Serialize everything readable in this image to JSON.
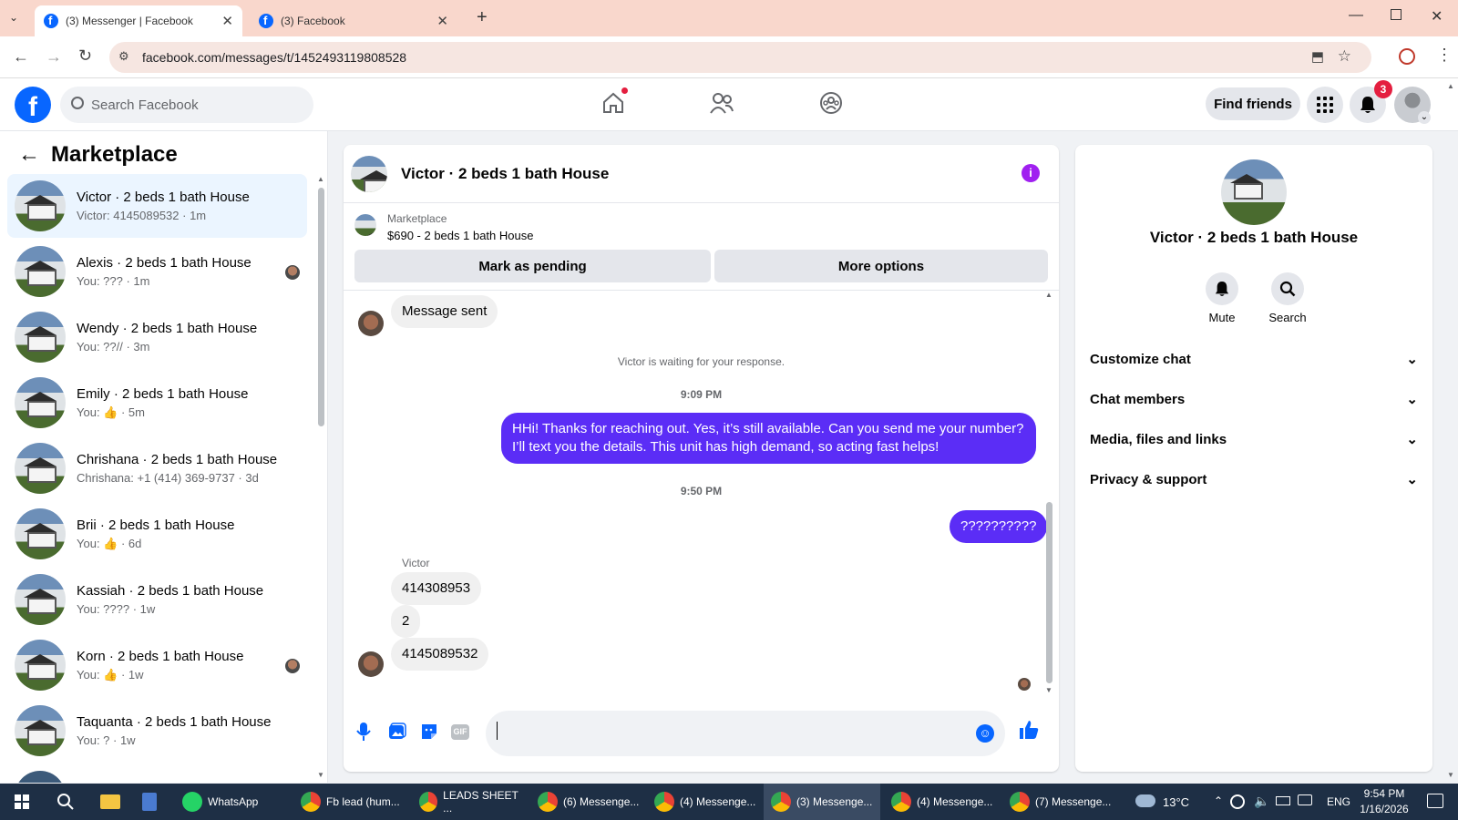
{
  "browser": {
    "tabs": [
      {
        "title": "(3) Messenger | Facebook",
        "active": true
      },
      {
        "title": "(3) Facebook",
        "active": false
      }
    ],
    "url": "facebook.com/messages/t/1452493119808528"
  },
  "fb_header": {
    "search_placeholder": "Search Facebook",
    "find_friends_label": "Find friends",
    "notification_count": "3"
  },
  "sidebar": {
    "title": "Marketplace",
    "conversations": [
      {
        "name": "Victor · 2 beds 1 bath House",
        "preview": "Victor: 4145089532 · 1m",
        "active": true
      },
      {
        "name": "Alexis · 2 beds 1 bath House",
        "preview": "You: ??? · 1m"
      },
      {
        "name": "Wendy · 2 beds 1 bath House",
        "preview": "You: ??// · 3m"
      },
      {
        "name": "Emily · 2 beds 1 bath House",
        "preview": "You: 👍 · 5m"
      },
      {
        "name": "Chrishana · 2 beds 1 bath House",
        "preview": "Chrishana: +1 (414) 369-9737 · 3d"
      },
      {
        "name": "Brii · 2 beds 1 bath House",
        "preview": "You: 👍 · 6d"
      },
      {
        "name": "Kassiah · 2 beds 1 bath House",
        "preview": "You: ???? · 1w"
      },
      {
        "name": "Korn · 2 beds 1 bath House",
        "preview": "You: 👍 · 1w"
      },
      {
        "name": "Taquanta · 2 beds 1 bath House",
        "preview": "You: ? · 1w"
      }
    ]
  },
  "chat": {
    "title": "Victor · 2 beds 1 bath House",
    "listing_label": "Marketplace",
    "listing_price": "$690 - 2 beds 1 bath House",
    "mark_pending_label": "Mark as pending",
    "more_options_label": "More options",
    "messages": {
      "sent_notice": "Message sent",
      "waiting": "Victor is waiting for your response.",
      "time1": "9:09 PM",
      "out1": "HHi! Thanks for reaching out. Yes, it’s still available. Can you send me your number? I’ll text you the details. This unit has high demand, so acting fast helps!",
      "time2": "9:50 PM",
      "out2": "??????????",
      "sender": "Victor",
      "in1": "414308953",
      "in2": "2",
      "in3": "4145089532"
    }
  },
  "info_panel": {
    "name": "Victor · 2 beds 1 bath House",
    "mute_label": "Mute",
    "search_label": "Search",
    "sections": [
      "Customize chat",
      "Chat members",
      "Media, files and links",
      "Privacy & support"
    ]
  },
  "taskbar": {
    "items": [
      {
        "label": "WhatsApp"
      },
      {
        "label": "Fb lead (hum..."
      },
      {
        "label": "LEADS SHEET ..."
      },
      {
        "label": "(6) Messenge..."
      },
      {
        "label": "(4) Messenge..."
      },
      {
        "label": "(3) Messenge...",
        "active": true
      },
      {
        "label": "(4) Messenge..."
      },
      {
        "label": "(7) Messenge..."
      }
    ],
    "temperature": "13°C",
    "language": "ENG",
    "time": "9:54 PM",
    "date": "1/16/2026"
  },
  "colors": {
    "brand": "#0866ff",
    "outgoing_bubble": "#5b2df6",
    "active_row": "#ebf5ff"
  }
}
